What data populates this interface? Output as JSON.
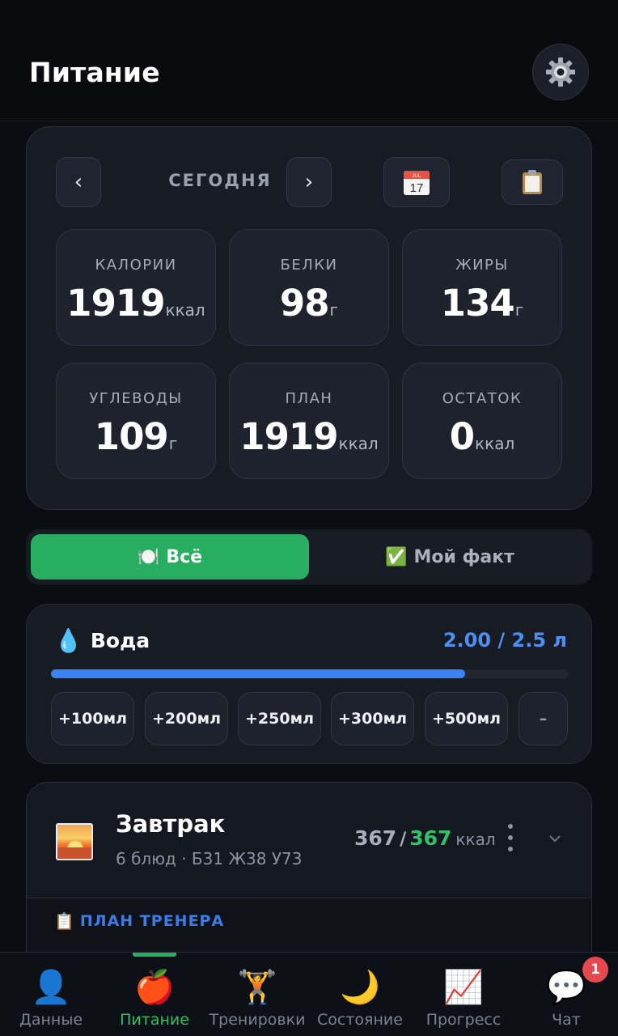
{
  "header": {
    "title": "Питание",
    "settings_icon": "gear-icon"
  },
  "summary": {
    "date_label": "СЕГОДНЯ",
    "prev_icon": "‹",
    "next_icon": "›",
    "calendar_day": "17",
    "calendar_month": "JUL",
    "stats": [
      {
        "label": "КАЛОРИИ",
        "value": "1919",
        "unit": "ккал"
      },
      {
        "label": "БЕЛКИ",
        "value": "98",
        "unit": "г"
      },
      {
        "label": "ЖИРЫ",
        "value": "134",
        "unit": "г"
      },
      {
        "label": "УГЛЕВОДЫ",
        "value": "109",
        "unit": "г"
      },
      {
        "label": "ПЛАН",
        "value": "1919",
        "unit": "ккал"
      },
      {
        "label": "ОСТАТОК",
        "value": "0",
        "unit": "ккал"
      }
    ]
  },
  "filter": {
    "all_icon": "🍽️",
    "all_label": "Всё",
    "fact_icon": "✅",
    "fact_label": "Мой факт"
  },
  "water": {
    "icon": "💧",
    "title": "Вода",
    "amount": "2.00 / 2.5 л",
    "progress": 0.8,
    "buttons": [
      "+100мл",
      "+200мл",
      "+250мл",
      "+300мл",
      "+500мл",
      "–"
    ]
  },
  "meal": {
    "name": "Завтрак",
    "subtitle": "6 блюд · Б31 Ж38 У73",
    "kcal_eaten": "367",
    "kcal_separator": "/",
    "kcal_plan": "367",
    "kcal_unit": "ккал",
    "plan_section_icon": "📋",
    "plan_section_label": "ПЛАН ТРЕНЕРА"
  },
  "nav": {
    "items": [
      {
        "icon": "👤",
        "label": "Данные"
      },
      {
        "icon": "🍎",
        "label": "Питание"
      },
      {
        "icon": "🏋️",
        "label": "Тренировки"
      },
      {
        "icon": "🌙",
        "label": "Состояние"
      },
      {
        "icon": "📈",
        "label": "Прогресс"
      },
      {
        "icon": "💬",
        "label": "Чат"
      }
    ],
    "active_index": 1,
    "chat_badge": "1"
  },
  "colors": {
    "accent_green": "#27ae60",
    "water_blue": "#3b82f6",
    "plan_blue": "#3d7be6"
  }
}
